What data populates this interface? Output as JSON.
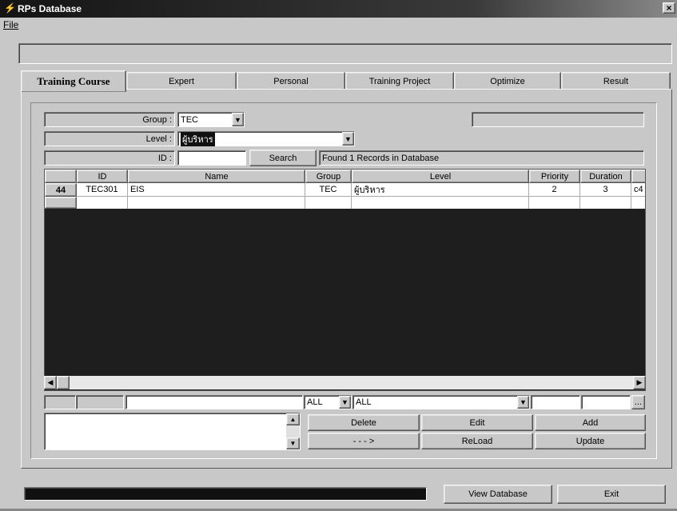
{
  "window": {
    "title": "RPs Database",
    "close": "×"
  },
  "menu": {
    "file": "File"
  },
  "tabs": [
    "Training Course",
    "Expert",
    "Personal",
    "Training Project",
    "Optimize",
    "Result"
  ],
  "filters": {
    "group_label": "Group :",
    "group_value": "TEC",
    "level_label": "Level :",
    "level_value": "ผู้บริหาร",
    "id_label": "ID :",
    "id_value": "",
    "search_button": "Search",
    "result_text": "Found 1 Records in Database"
  },
  "grid": {
    "columns": [
      "ID",
      "Name",
      "Group",
      "Level",
      "Priority",
      "Duration"
    ],
    "rows": [
      {
        "num": "44",
        "id": "TEC301",
        "name": "EIS",
        "group": "TEC",
        "level": "ผู้บริหาร",
        "priority": "2",
        "duration": "3",
        "extra": "c4"
      }
    ]
  },
  "bottom_filters": {
    "group": "ALL",
    "level": "ALL",
    "browse": "..."
  },
  "buttons": {
    "delete": "Delete",
    "edit": "Edit",
    "add": "Add",
    "next": "- - - >",
    "reload": "ReLoad",
    "update": "Update",
    "view_database": "View Database",
    "exit": "Exit"
  }
}
